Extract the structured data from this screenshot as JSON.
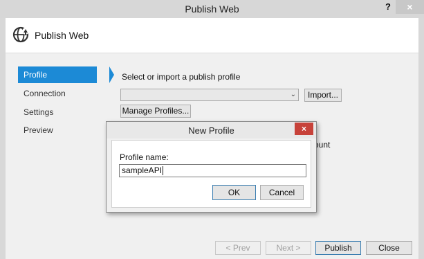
{
  "window": {
    "title": "Publish Web",
    "help_glyph": "?",
    "close_glyph": "×"
  },
  "header": {
    "title": "Publish Web"
  },
  "nav": {
    "items": [
      {
        "label": "Profile"
      },
      {
        "label": "Connection"
      },
      {
        "label": "Settings"
      },
      {
        "label": "Preview"
      }
    ]
  },
  "profile": {
    "heading": "Select or import a publish profile",
    "combo_value": "",
    "import_label": "Import...",
    "manage_label": "Manage Profiles...",
    "partial_text": "ount"
  },
  "dialog": {
    "title": "New Profile",
    "close_glyph": "×",
    "field_label": "Profile name:",
    "field_value": "sampleAPI",
    "ok_label": "OK",
    "cancel_label": "Cancel"
  },
  "footer": {
    "prev_label": "< Prev",
    "next_label": "Next >",
    "publish_label": "Publish",
    "close_label": "Close"
  }
}
